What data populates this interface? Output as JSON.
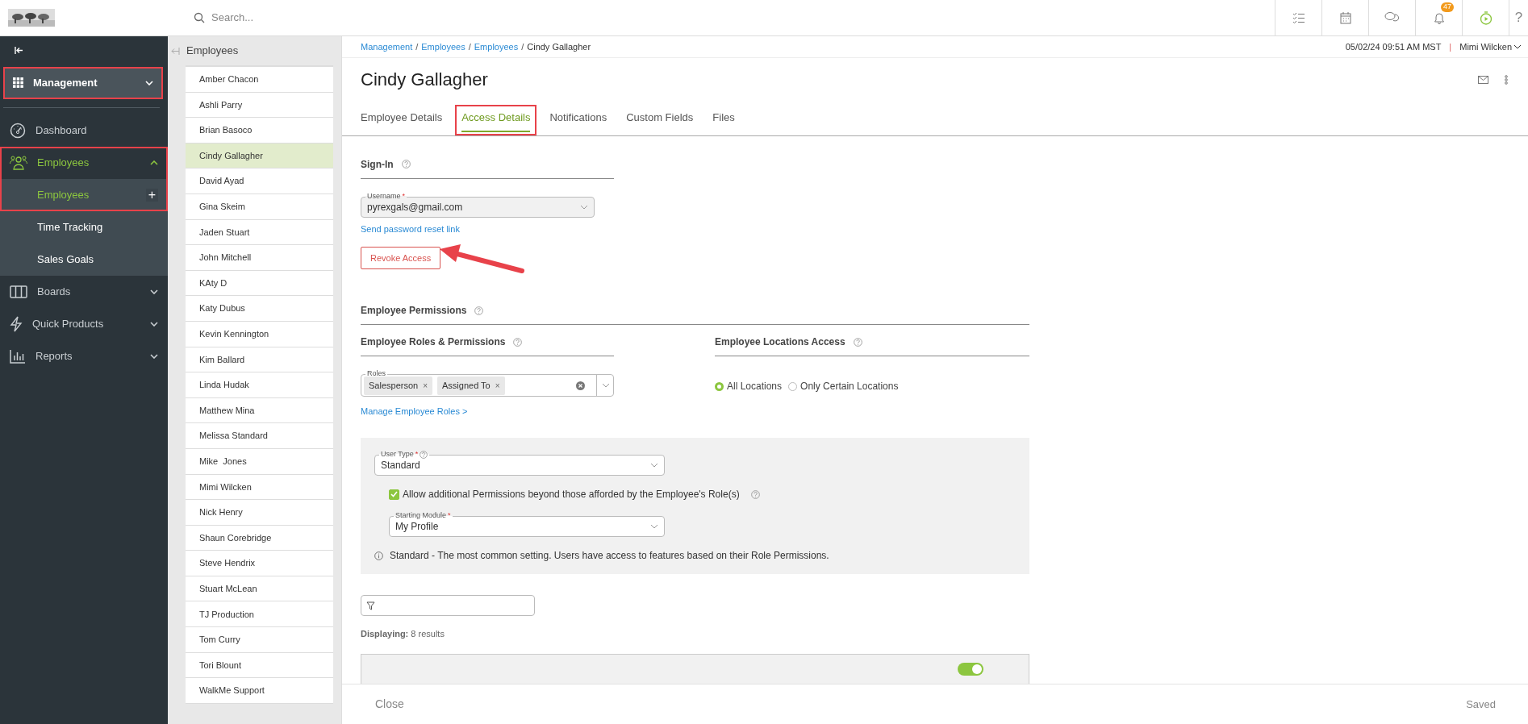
{
  "topbar": {
    "search_placeholder": "Search...",
    "notification_count": "47",
    "help": "?"
  },
  "sidebar": {
    "module": {
      "label": "Management",
      "highlighted": true
    },
    "items": [
      {
        "kind": "link",
        "label": "Dashboard"
      },
      {
        "kind": "group",
        "label": "Employees",
        "expanded": true,
        "selected": true,
        "highlighted": true,
        "children": [
          {
            "label": "Employees",
            "selected": true,
            "add": "+"
          },
          {
            "label": "Time Tracking",
            "selected": false
          },
          {
            "label": "Sales Goals",
            "selected": false
          }
        ]
      },
      {
        "kind": "group",
        "label": "Boards",
        "expanded": false,
        "selected": false,
        "highlighted": false
      },
      {
        "kind": "group",
        "label": "Quick Products",
        "expanded": false,
        "selected": false,
        "highlighted": false
      },
      {
        "kind": "group",
        "label": "Reports",
        "expanded": false,
        "selected": false,
        "highlighted": false
      }
    ]
  },
  "employee_list": {
    "title": "Employees",
    "items": [
      {
        "name": "Amber Chacon",
        "selected": false
      },
      {
        "name": "Ashli Parry",
        "selected": false
      },
      {
        "name": "Brian Basoco",
        "selected": false
      },
      {
        "name": "Cindy Gallagher",
        "selected": true
      },
      {
        "name": "David Ayad",
        "selected": false
      },
      {
        "name": "Gina Skeim",
        "selected": false
      },
      {
        "name": "Jaden Stuart",
        "selected": false
      },
      {
        "name": "John Mitchell",
        "selected": false
      },
      {
        "name": "KAty D",
        "selected": false
      },
      {
        "name": "Katy Dubus",
        "selected": false
      },
      {
        "name": "Kevin Kennington",
        "selected": false
      },
      {
        "name": "Kim Ballard",
        "selected": false
      },
      {
        "name": "Linda Hudak",
        "selected": false
      },
      {
        "name": "Matthew Mina",
        "selected": false
      },
      {
        "name": "Melissa Standard",
        "selected": false
      },
      {
        "name": "Mike  Jones",
        "selected": false
      },
      {
        "name": "Mimi Wilcken",
        "selected": false
      },
      {
        "name": "Nick Henry",
        "selected": false
      },
      {
        "name": "Shaun Corebridge",
        "selected": false
      },
      {
        "name": "Steve Hendrix",
        "selected": false
      },
      {
        "name": "Stuart McLean",
        "selected": false
      },
      {
        "name": "TJ Production",
        "selected": false
      },
      {
        "name": "Tom Curry",
        "selected": false
      },
      {
        "name": "Tori Blount",
        "selected": false
      },
      {
        "name": "WalkMe Support",
        "selected": false
      }
    ]
  },
  "header": {
    "breadcrumb": [
      {
        "label": "Management",
        "link": true
      },
      {
        "label": "Employees",
        "link": true
      },
      {
        "label": "Employees",
        "link": true
      },
      {
        "label": "Cindy Gallagher",
        "link": false
      }
    ],
    "breadcrumb_separator": "/",
    "datetime": "05/02/24 09:51 AM MST",
    "divider": "|",
    "user": "Mimi Wilcken"
  },
  "title": "Cindy Gallagher",
  "tabs": [
    {
      "label": "Employee Details",
      "selected": false,
      "highlighted": false
    },
    {
      "label": "Access Details",
      "selected": true,
      "highlighted": true
    },
    {
      "label": "Notifications",
      "selected": false,
      "highlighted": false
    },
    {
      "label": "Custom Fields",
      "selected": false,
      "highlighted": false
    },
    {
      "label": "Files",
      "selected": false,
      "highlighted": false
    }
  ],
  "sign_in": {
    "heading": "Sign-In",
    "username": {
      "label": "Username",
      "required": true,
      "required_mark": "*",
      "value": "pyrexgals@gmail.com"
    },
    "reset_link": "Send password reset link",
    "revoke_button": {
      "label": "Revoke Access",
      "pointed_at": true
    }
  },
  "permissions": {
    "heading": "Employee Permissions",
    "roles": {
      "heading": "Employee Roles & Permissions",
      "field_label": "Roles",
      "tags": [
        {
          "label": "Salesperson",
          "remove": "×"
        },
        {
          "label": "Assigned To",
          "remove": "×"
        }
      ],
      "manage_link": "Manage Employee Roles >"
    },
    "locations": {
      "heading": "Employee Locations Access",
      "options": [
        {
          "label": "All Locations",
          "selected": true
        },
        {
          "label": "Only Certain Locations",
          "selected": false
        }
      ]
    },
    "user_type": {
      "label": "User Type",
      "required": true,
      "required_mark": "*",
      "value": "Standard"
    },
    "allow_additional": {
      "label": "Allow additional Permissions beyond those afforded by the Employee's Role(s)",
      "checked": true
    },
    "starting_module": {
      "label": "Starting Module",
      "required": true,
      "required_mark": "*",
      "value": "My Profile"
    },
    "info": "Standard - The most common setting. Users have access to features based on their Role Permissions."
  },
  "filter": {
    "displaying_label": "Displaying:",
    "displaying_value": "8 results"
  },
  "permission_card": {
    "on": true
  },
  "footer": {
    "close": "Close",
    "status": "Saved"
  }
}
